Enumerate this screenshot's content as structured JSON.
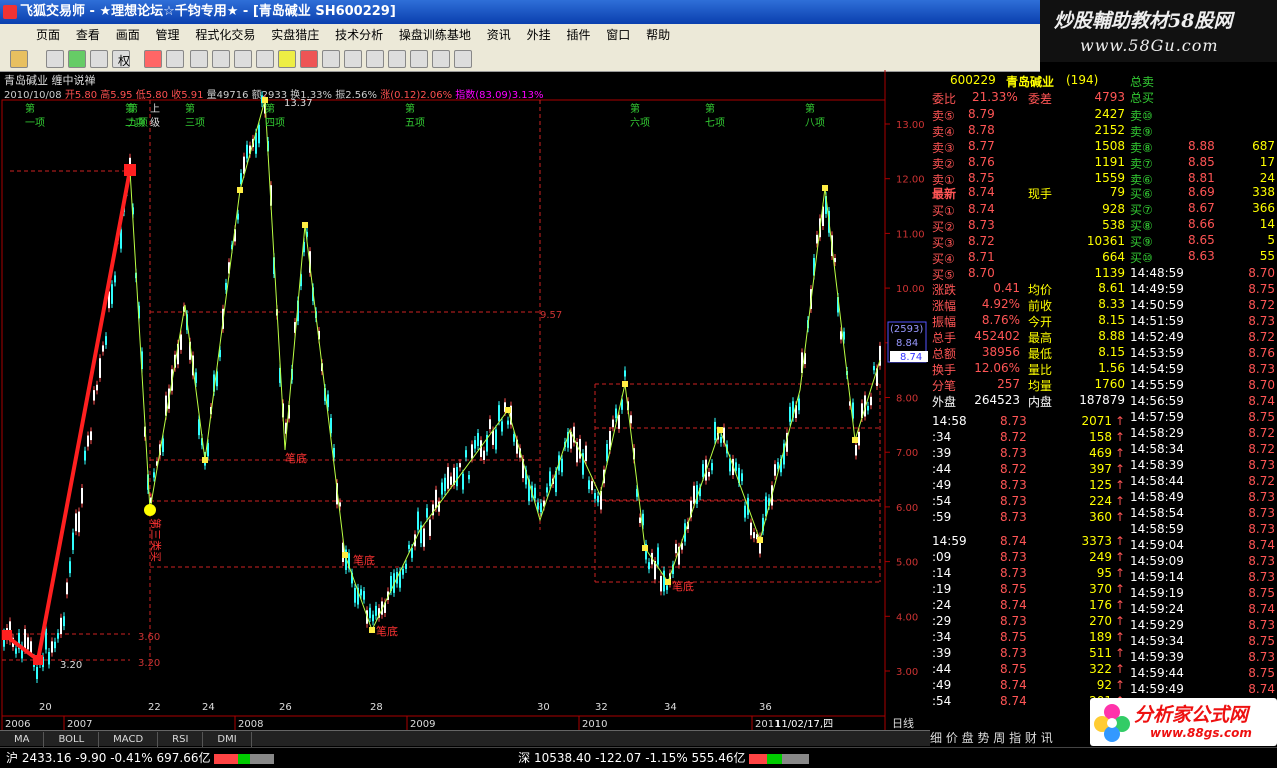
{
  "app": {
    "title": "飞狐交易师 - ★理想论坛☆千钧专用★ - [青岛碱业 SH600229]"
  },
  "watermark_top": {
    "line1": "炒股輔助教材58股网",
    "line2": "www.58Gu.com"
  },
  "watermark_bottom": {
    "line1": "分析家公式网",
    "line2": "www.88gs.com"
  },
  "menu": [
    "页面",
    "查看",
    "画面",
    "管理",
    "程式化交易",
    "实盘猎庄",
    "技术分析",
    "操盘训练基地",
    "资讯",
    "外挂",
    "插件",
    "窗口",
    "帮助"
  ],
  "toolbar": {
    "rights_label": "权"
  },
  "chart": {
    "name": "青岛碱业 缠中说禅",
    "date": "2010/10/08",
    "open_label": "开",
    "open": "5.80",
    "high_label": "高",
    "high": "5.95",
    "low_label": "低",
    "low": "5.80",
    "close_label": "收",
    "close": "5.91",
    "vol_label": "量",
    "vol": "49716",
    "amt_label": "额",
    "amt": "2933",
    "turnover_label": "换",
    "turnover": "1.33%",
    "amp_label": "振",
    "amp": "2.56%",
    "rise_label": "涨",
    "rise": "(0.12)",
    "rise_pct": "2.06%",
    "index_label": "指数",
    "index_val": "(83.09)",
    "index_pct": "3.13%",
    "yticks": [
      "13.00",
      "12.00",
      "11.00",
      "10.00",
      "9.00",
      "8.00",
      "7.00",
      "6.00",
      "5.00",
      "4.00",
      "3.00"
    ],
    "xticks": [
      "20",
      "22",
      "24",
      "26",
      "28",
      "30",
      "32",
      "34",
      "36"
    ],
    "years": [
      "2006",
      "2007",
      "2008",
      "2009",
      "2010",
      "2011"
    ],
    "cursor_date": "11/02/17,四",
    "period": "日线",
    "labels": {
      "top_13": "13.37",
      "low_320": "3.20",
      "lvl_360": "3.60",
      "lvl_320": "3.20",
      "lvl_957": "9.57",
      "bi_di1": "笔底",
      "bi_di2": "笔底",
      "bi_di3": "笔底",
      "bi_di4": "笔底",
      "third_buy": "第三类买",
      "up_label": "上",
      "up_label2": "级"
    },
    "top_marks": [
      "第一项",
      "第二项",
      "第三项",
      "第四项",
      "第五项",
      "第六项",
      "第七项",
      "第八项",
      "第九项"
    ],
    "right_tags": {
      "t1": "(2593)",
      "t2": "8.84",
      "t3": "8.74"
    }
  },
  "indicator_tabs": [
    "MA",
    "BOLL",
    "MACD",
    "RSI",
    "DMI"
  ],
  "quote": {
    "code": "600229",
    "name": "青岛碱业",
    "count": "(194)",
    "weibi_label": "委比",
    "weibi": "21.33%",
    "weicha_label": "委差",
    "weicha": "4793",
    "sells": [
      {
        "l": "卖⑤",
        "p": "8.79",
        "v": "2427"
      },
      {
        "l": "卖④",
        "p": "8.78",
        "v": "2152"
      },
      {
        "l": "卖③",
        "p": "8.77",
        "v": "1508"
      },
      {
        "l": "卖②",
        "p": "8.76",
        "v": "1191"
      },
      {
        "l": "卖①",
        "p": "8.75",
        "v": "1559"
      }
    ],
    "latest_label": "最新",
    "latest": "8.74",
    "xianshou_label": "现手",
    "xianshou": "79",
    "buys": [
      {
        "l": "买①",
        "p": "8.74",
        "v": "928"
      },
      {
        "l": "买②",
        "p": "8.73",
        "v": "538"
      },
      {
        "l": "买③",
        "p": "8.72",
        "v": "10361"
      },
      {
        "l": "买④",
        "p": "8.71",
        "v": "664"
      },
      {
        "l": "买⑤",
        "p": "8.70",
        "v": "1139"
      }
    ],
    "stats": [
      {
        "a": "涨跌",
        "av": "0.41",
        "b": "均价",
        "bv": "8.61"
      },
      {
        "a": "涨幅",
        "av": "4.92%",
        "b": "前收",
        "bv": "8.33"
      },
      {
        "a": "振幅",
        "av": "8.76%",
        "b": "今开",
        "bv": "8.15"
      },
      {
        "a": "总手",
        "av": "452402",
        "b": "最高",
        "bv": "8.88"
      },
      {
        "a": "总额",
        "av": "38956",
        "b": "最低",
        "bv": "8.15"
      },
      {
        "a": "换手",
        "av": "12.06%",
        "b": "量比",
        "bv": "1.56"
      },
      {
        "a": "分笔",
        "av": "257",
        "b": "均量",
        "bv": "1760"
      }
    ],
    "waipan_label": "外盘",
    "waipan": "264523",
    "neipan_label": "内盘",
    "neipan": "187879",
    "ticks": [
      {
        "t": "14:58",
        "p": "8.73",
        "v": "2071"
      },
      {
        "t": ":34",
        "p": "8.72",
        "v": "158"
      },
      {
        "t": ":39",
        "p": "8.73",
        "v": "469"
      },
      {
        "t": ":44",
        "p": "8.72",
        "v": "397"
      },
      {
        "t": ":49",
        "p": "8.73",
        "v": "125"
      },
      {
        "t": ":54",
        "p": "8.73",
        "v": "224"
      },
      {
        "t": ":59",
        "p": "8.73",
        "v": "360"
      },
      {
        "t": "14:59",
        "p": "8.74",
        "v": "3373"
      },
      {
        "t": ":09",
        "p": "8.73",
        "v": "249"
      },
      {
        "t": ":14",
        "p": "8.73",
        "v": "95"
      },
      {
        "t": ":19",
        "p": "8.75",
        "v": "370"
      },
      {
        "t": ":24",
        "p": "8.74",
        "v": "176"
      },
      {
        "t": ":29",
        "p": "8.73",
        "v": "270"
      },
      {
        "t": ":34",
        "p": "8.75",
        "v": "189"
      },
      {
        "t": ":39",
        "p": "8.73",
        "v": "511"
      },
      {
        "t": ":44",
        "p": "8.75",
        "v": "322"
      },
      {
        "t": ":49",
        "p": "8.74",
        "v": "92"
      },
      {
        "t": ":54",
        "p": "8.74",
        "v": "201"
      },
      {
        "t": ":59",
        "p": "8.74",
        "v": "4"
      },
      {
        "t": "15:00",
        "p": "8.74",
        "v": "0"
      }
    ],
    "far_label1": "总卖",
    "far_label2": "总买",
    "far_sells": [
      {
        "l": "卖⑩",
        "p": "",
        "v": ""
      },
      {
        "l": "卖⑨",
        "p": "",
        "v": ""
      },
      {
        "l": "卖⑧",
        "p": "8.88",
        "v": "687"
      },
      {
        "l": "卖⑦",
        "p": "8.85",
        "v": "17"
      },
      {
        "l": "卖⑥",
        "p": "8.81",
        "v": "24"
      }
    ],
    "far_buys": [
      {
        "l": "买⑥",
        "p": "8.69",
        "v": "338"
      },
      {
        "l": "买⑦",
        "p": "8.67",
        "v": "366"
      },
      {
        "l": "买⑧",
        "p": "8.66",
        "v": "14"
      },
      {
        "l": "买⑨",
        "p": "8.65",
        "v": "5"
      },
      {
        "l": "买⑩",
        "p": "8.63",
        "v": "55"
      }
    ],
    "far_ticks": [
      {
        "t": "14:48:59",
        "p": "8.70"
      },
      {
        "t": "14:49:59",
        "p": "8.75"
      },
      {
        "t": "14:50:59",
        "p": "8.72"
      },
      {
        "t": "14:51:59",
        "p": "8.73"
      },
      {
        "t": "14:52:49",
        "p": "8.72"
      },
      {
        "t": "14:53:59",
        "p": "8.76"
      },
      {
        "t": "14:54:59",
        "p": "8.73"
      },
      {
        "t": "14:55:59",
        "p": "8.70"
      },
      {
        "t": "14:56:59",
        "p": "8.74"
      },
      {
        "t": "14:57:59",
        "p": "8.75"
      },
      {
        "t": "14:58:29",
        "p": "8.72"
      },
      {
        "t": "14:58:34",
        "p": "8.72"
      },
      {
        "t": "14:58:39",
        "p": "8.73"
      },
      {
        "t": "14:58:44",
        "p": "8.72"
      },
      {
        "t": "14:58:49",
        "p": "8.73"
      },
      {
        "t": "14:58:54",
        "p": "8.73"
      },
      {
        "t": "14:58:59",
        "p": "8.73"
      },
      {
        "t": "14:59:04",
        "p": "8.74"
      },
      {
        "t": "14:59:09",
        "p": "8.73"
      },
      {
        "t": "14:59:14",
        "p": "8.73"
      },
      {
        "t": "14:59:19",
        "p": "8.75"
      },
      {
        "t": "14:59:24",
        "p": "8.74"
      },
      {
        "t": "14:59:29",
        "p": "8.73"
      },
      {
        "t": "14:59:34",
        "p": "8.75"
      },
      {
        "t": "14:59:39",
        "p": "8.73"
      },
      {
        "t": "14:59:44",
        "p": "8.75"
      },
      {
        "t": "14:59:49",
        "p": "8.74"
      }
    ],
    "tabs": "细 价 盘 势 周 指 财 讯"
  },
  "status": {
    "sh_label": "沪",
    "sh": "2433.16",
    "sh_chg": "-9.90",
    "sh_pct": "-0.41%",
    "sh_amt": "697.66亿",
    "sz_label": "深",
    "sz": "10538.40",
    "sz_chg": "-122.07",
    "sz_pct": "-1.15%",
    "sz_amt": "555.46亿"
  },
  "colors": {
    "up": "#ff4040",
    "down": "#00ffff",
    "ma": "#ffffff",
    "bi": "#ff2020",
    "accent": "#ffff00"
  }
}
